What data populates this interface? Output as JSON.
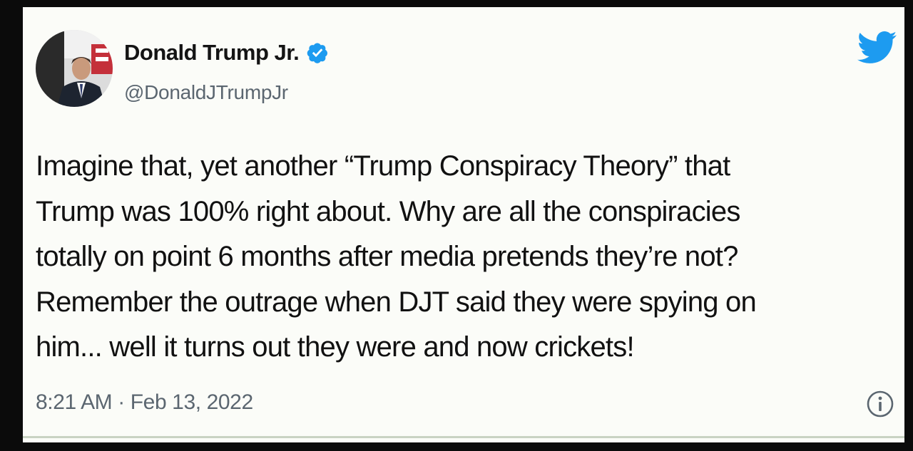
{
  "tweet": {
    "display_name": "Donald Trump Jr.",
    "handle": "@DonaldJTrumpJr",
    "verified": true,
    "text_lines": [
      "Imagine that, yet another “Trump Conspiracy Theory” that",
      "Trump was 100% right about. Why are all the conspiracies",
      "totally on point 6 months after media pretends they’re not?",
      "Remember the outrage when DJT said they were spying on",
      "him... well it turns out they were and now crickets!"
    ],
    "timestamp": "8:21 AM · Feb 13, 2022"
  },
  "icons": {
    "verified": "verified-badge-icon",
    "brand": "twitter-bird-icon",
    "info": "info-icon"
  },
  "colors": {
    "twitter_blue": "#1d9bf0",
    "text_primary": "#111111",
    "text_secondary": "#5b6670",
    "card_background": "#fbfcf8"
  }
}
